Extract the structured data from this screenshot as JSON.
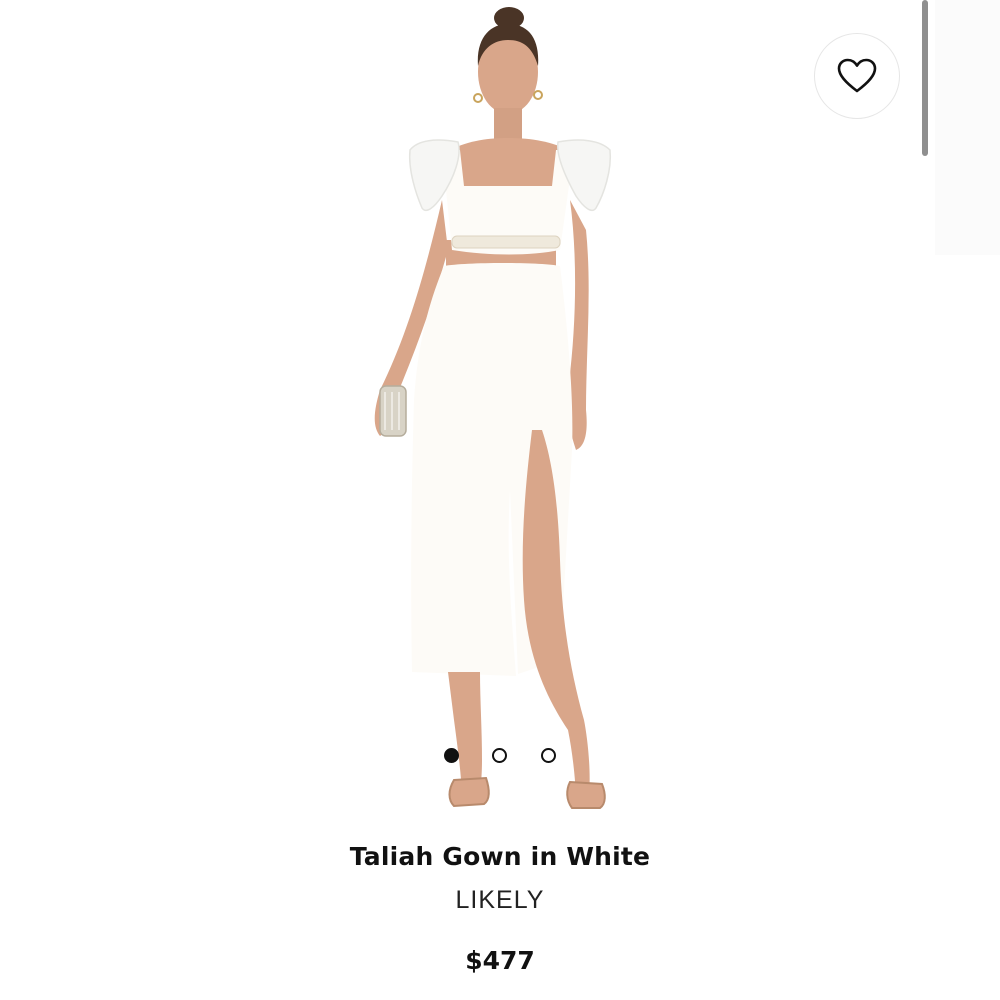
{
  "favorite": {
    "icon": "heart-icon"
  },
  "product": {
    "title": "Taliah Gown in White",
    "brand": "LIKELY",
    "price": "$477"
  },
  "carousel": {
    "total": 3,
    "active_index": 0
  },
  "colors": {
    "dress": "#fdfbf7",
    "skin": "#d9a68a",
    "hair": "#4a3426"
  }
}
